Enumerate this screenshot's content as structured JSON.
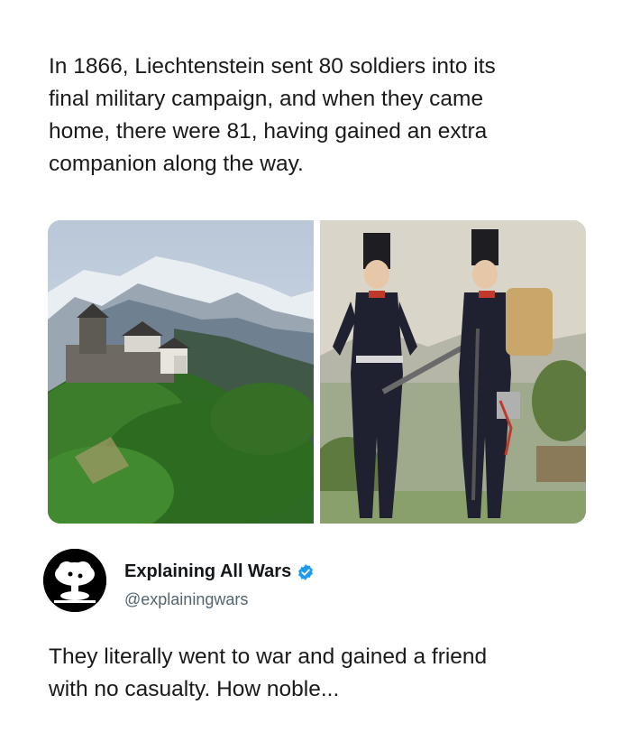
{
  "quoted_post": {
    "text": "In 1866, Liechtenstein sent 80 soldiers into its\nfinal military campaign, and when they came\nhome, there were 81, having gained an extra\ncompanion along the way."
  },
  "media": {
    "left_image_icon": "castle-mountain-photo",
    "right_image_icon": "soldiers-illustration"
  },
  "author": {
    "display_name": "Explaining All Wars",
    "handle": "@explainingwars",
    "verified_color": "#1d9bf0",
    "avatar_icon": "mushroom-cloud-icon"
  },
  "post": {
    "text": "They literally went to war and gained a friend\nwith no casualty. How noble..."
  }
}
